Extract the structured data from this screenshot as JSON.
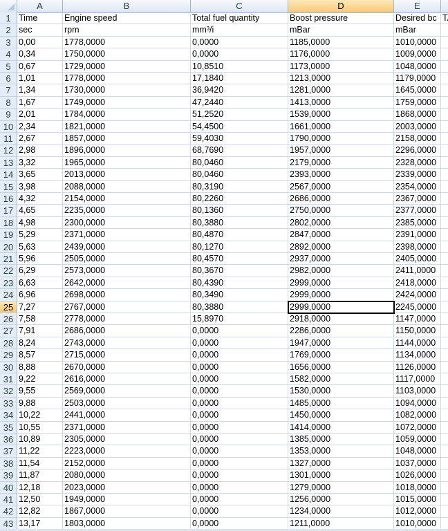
{
  "columns": [
    "A",
    "B",
    "C",
    "D",
    "E",
    ""
  ],
  "active_cell": {
    "column": "D",
    "row": "25"
  },
  "rows": [
    [
      "1",
      "Time",
      "Engine speed",
      "Total fuel quantity",
      "Boost pressure",
      "Desired bc",
      "TA"
    ],
    [
      "2",
      "sec",
      "rpm",
      "mm³/i",
      "mBar",
      "mBar",
      ""
    ],
    [
      "3",
      "0,00",
      "1778,0000",
      "0,0000",
      "1185,0000",
      "1010,0000",
      ""
    ],
    [
      "4",
      "0,34",
      "1750,0000",
      "0,0000",
      "1176,0000",
      "1009,0000",
      ""
    ],
    [
      "5",
      "0,67",
      "1729,0000",
      "10,8510",
      "1173,0000",
      "1048,0000",
      ""
    ],
    [
      "6",
      "1,01",
      "1778,0000",
      "17,1840",
      "1213,0000",
      "1179,0000",
      ""
    ],
    [
      "7",
      "1,34",
      "1730,0000",
      "36,9420",
      "1281,0000",
      "1645,0000",
      ""
    ],
    [
      "8",
      "1,67",
      "1749,0000",
      "47,2440",
      "1413,0000",
      "1759,0000",
      ""
    ],
    [
      "9",
      "2,01",
      "1784,0000",
      "51,2520",
      "1539,0000",
      "1868,0000",
      ""
    ],
    [
      "10",
      "2,34",
      "1821,0000",
      "54,4500",
      "1661,0000",
      "2003,0000",
      ""
    ],
    [
      "11",
      "2,67",
      "1857,0000",
      "59,4030",
      "1790,0000",
      "2158,0000",
      ""
    ],
    [
      "12",
      "2,98",
      "1896,0000",
      "68,7690",
      "1957,0000",
      "2296,0000",
      ""
    ],
    [
      "13",
      "3,32",
      "1965,0000",
      "80,0460",
      "2179,0000",
      "2328,0000",
      ""
    ],
    [
      "14",
      "3,65",
      "2013,0000",
      "80,0460",
      "2393,0000",
      "2339,0000",
      ""
    ],
    [
      "15",
      "3,98",
      "2088,0000",
      "80,3190",
      "2567,0000",
      "2354,0000",
      ""
    ],
    [
      "16",
      "4,32",
      "2154,0000",
      "80,2260",
      "2686,0000",
      "2367,0000",
      ""
    ],
    [
      "17",
      "4,65",
      "2235,0000",
      "80,1360",
      "2750,0000",
      "2377,0000",
      ""
    ],
    [
      "18",
      "4,98",
      "2300,0000",
      "80,3880",
      "2802,0000",
      "2385,0000",
      ""
    ],
    [
      "19",
      "5,29",
      "2371,0000",
      "80,4870",
      "2847,0000",
      "2391,0000",
      ""
    ],
    [
      "20",
      "5,63",
      "2439,0000",
      "80,1270",
      "2892,0000",
      "2398,0000",
      ""
    ],
    [
      "21",
      "5,96",
      "2505,0000",
      "80,4570",
      "2937,0000",
      "2405,0000",
      ""
    ],
    [
      "22",
      "6,29",
      "2573,0000",
      "80,3670",
      "2982,0000",
      "2411,0000",
      ""
    ],
    [
      "23",
      "6,63",
      "2642,0000",
      "80,4390",
      "2999,0000",
      "2418,0000",
      ""
    ],
    [
      "24",
      "6,96",
      "2698,0000",
      "80,3490",
      "2999,0000",
      "2424,0000",
      ""
    ],
    [
      "25",
      "7,27",
      "2767,0000",
      "80,3880",
      "2999,0000",
      "2245,0000",
      ""
    ],
    [
      "26",
      "7,58",
      "2778,0000",
      "15,8970",
      "2918,0000",
      "1147,0000",
      ""
    ],
    [
      "27",
      "7,91",
      "2686,0000",
      "0,0000",
      "2286,0000",
      "1150,0000",
      ""
    ],
    [
      "28",
      "8,24",
      "2743,0000",
      "0,0000",
      "1947,0000",
      "1144,0000",
      ""
    ],
    [
      "29",
      "8,57",
      "2715,0000",
      "0,0000",
      "1769,0000",
      "1134,0000",
      ""
    ],
    [
      "30",
      "8,88",
      "2670,0000",
      "0,0000",
      "1656,0000",
      "1126,0000",
      ""
    ],
    [
      "31",
      "9,22",
      "2616,0000",
      "0,0000",
      "1582,0000",
      "1117,0000",
      ""
    ],
    [
      "32",
      "9,55",
      "2569,0000",
      "0,0000",
      "1530,0000",
      "1103,0000",
      ""
    ],
    [
      "33",
      "9,88",
      "2503,0000",
      "0,0000",
      "1485,0000",
      "1094,0000",
      ""
    ],
    [
      "34",
      "10,22",
      "2441,0000",
      "0,0000",
      "1450,0000",
      "1082,0000",
      ""
    ],
    [
      "35",
      "10,55",
      "2371,0000",
      "0,0000",
      "1414,0000",
      "1072,0000",
      ""
    ],
    [
      "36",
      "10,89",
      "2305,0000",
      "0,0000",
      "1385,0000",
      "1059,0000",
      ""
    ],
    [
      "37",
      "11,22",
      "2223,0000",
      "0,0000",
      "1353,0000",
      "1048,0000",
      ""
    ],
    [
      "38",
      "11,54",
      "2152,0000",
      "0,0000",
      "1327,0000",
      "1037,0000",
      ""
    ],
    [
      "39",
      "11,87",
      "2080,0000",
      "0,0000",
      "1301,0000",
      "1026,0000",
      ""
    ],
    [
      "40",
      "12,18",
      "2023,0000",
      "0,0000",
      "1279,0000",
      "1018,0000",
      ""
    ],
    [
      "41",
      "12,50",
      "1949,0000",
      "0,0000",
      "1256,0000",
      "1015,0000",
      ""
    ],
    [
      "42",
      "12,82",
      "1867,0000",
      "0,0000",
      "1234,0000",
      "1012,0000",
      ""
    ],
    [
      "43",
      "13,17",
      "1803,0000",
      "0,0000",
      "1211,0000",
      "1010,0000",
      ""
    ]
  ]
}
